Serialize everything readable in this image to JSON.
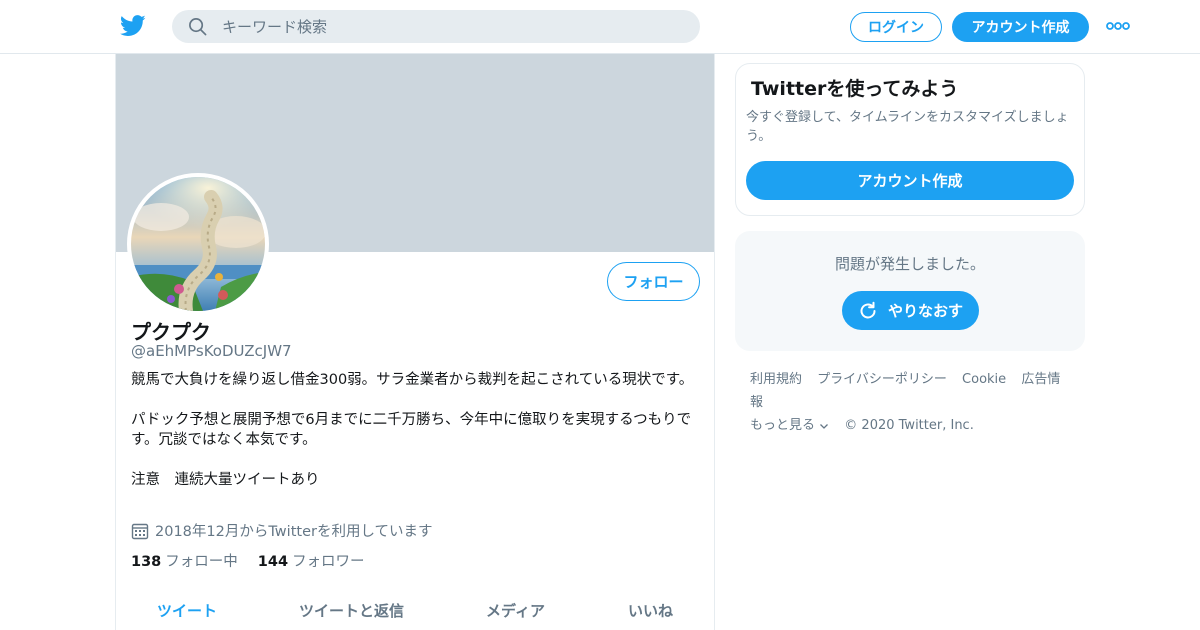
{
  "colors": {
    "accent": "#1da1f2",
    "banner": "#ccd6dd",
    "muted": "#657786",
    "text": "#14171a"
  },
  "header": {
    "logo_icon": "twitter-bird-icon",
    "search_placeholder": "キーワード検索",
    "login_label": "ログイン",
    "signup_label": "アカウント作成",
    "more_icon": "more-dots-icon"
  },
  "profile": {
    "display_name": "プクプク",
    "handle": "@aEhMPsKoDUZcJW7",
    "follow_label": "フォロー",
    "bio_paragraphs": [
      "競馬で大負けを繰り返し借金300弱。サラ金業者から裁判を起こされている現状です。",
      "パドック予想と展開予想で6月までに二千万勝ち、今年中に億取りを実現するつもりです。冗談ではなく本気です。",
      "注意　連続大量ツイートあり"
    ],
    "joined": "2018年12月からTwitterを利用しています",
    "following_count": "138",
    "following_label": "フォロー中",
    "followers_count": "144",
    "followers_label": "フォロワー",
    "tabs": [
      "ツイート",
      "ツイートと返信",
      "メディア",
      "いいね"
    ]
  },
  "sidebar": {
    "signup_card": {
      "title": "Twitterを使ってみよう",
      "description": "今すぐ登録して、タイムラインをカスタマイズしましょう。",
      "button_label": "アカウント作成"
    },
    "error_card": {
      "message": "問題が発生しました。",
      "retry_label": "やりなおす"
    },
    "footer": {
      "links": [
        "利用規約",
        "プライバシーポリシー",
        "Cookie",
        "広告情報"
      ],
      "more_label": "もっと見る",
      "copyright": "© 2020 Twitter, Inc."
    }
  }
}
